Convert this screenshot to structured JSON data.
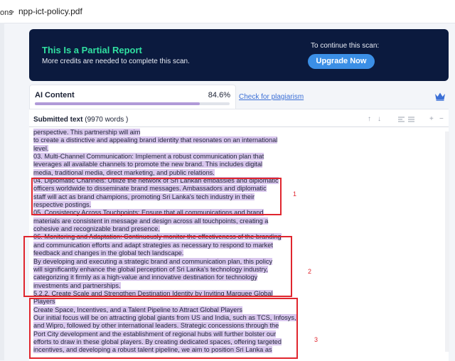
{
  "breadcrumb": {
    "prev": "ons",
    "separator": ">",
    "file": "npp-ict-policy.pdf"
  },
  "banner": {
    "title": "This Is a Partial Report",
    "subtitle": "More credits are needed to complete this scan.",
    "cta_text": "To continue this scan:",
    "upgrade_label": "Upgrade Now"
  },
  "tabs": {
    "ai_label": "AI Content",
    "ai_percent": "84.6%",
    "ai_value": 84.6,
    "plagiarism_label": "Check for plagiarism"
  },
  "submitted": {
    "label": "Submitted text",
    "word_count": "(9970 words )"
  },
  "highlight_color": "#d9c7ee",
  "markers": [
    "1",
    "2",
    "3"
  ],
  "lines": [
    "perspective. This partnership will aim",
    "to create a distinctive and appealing brand identity that resonates on an international",
    "level.",
    "03. Multi-Channel Communication: Implement a robust communication plan that",
    "leverages all available channels to promote the new brand. This includes digital",
    "media, traditional media, direct marketing, and public relations.",
    "04. Diplomatic Channels: Utilize the network of Sri Lankan embassies and diplomatic",
    "officers worldwide to disseminate brand messages. Ambassadors and diplomatic",
    "staff will act as brand champions, promoting Sri Lanka's tech industry in their",
    "respective postings.",
    "05. Consistency Across Touchpoints: Ensure that all communications and brand",
    "materials are consistent in message and design across all touchpoints, creating a",
    "cohesive and recognizable brand presence.",
    "06. Monitoring and Adaptation: Continuously monitor the effectiveness of the branding",
    "and communication efforts and adapt strategies as necessary to respond to market",
    "feedback and changes in the global tech landscape.",
    "By developing and executing a strategic brand and communication plan, this policy",
    "will significantly enhance the global perception of Sri Lanka's technology industry,",
    "categorizing it firmly as a high-value and innovative destination for technology",
    "investments and partnerships.",
    "5.2.2. Create Scale and Strengthen Destination Identity by Inviting Marquee Global",
    "Players",
    "Create Space, Incentives, and a Talent Pipeline to Attract Global Players",
    "Our initial focus will be on attracting global giants from US and India, such as TCS, Infosys,",
    "and Wipro, followed by other international leaders. Strategic concessions through the",
    "Port City development and the establishment of regional hubs will further bolster our",
    "efforts to draw in these global players. By creating dedicated spaces, offering targeted",
    "incentives, and developing a robust talent pipeline, we aim to position Sri Lanka as"
  ]
}
